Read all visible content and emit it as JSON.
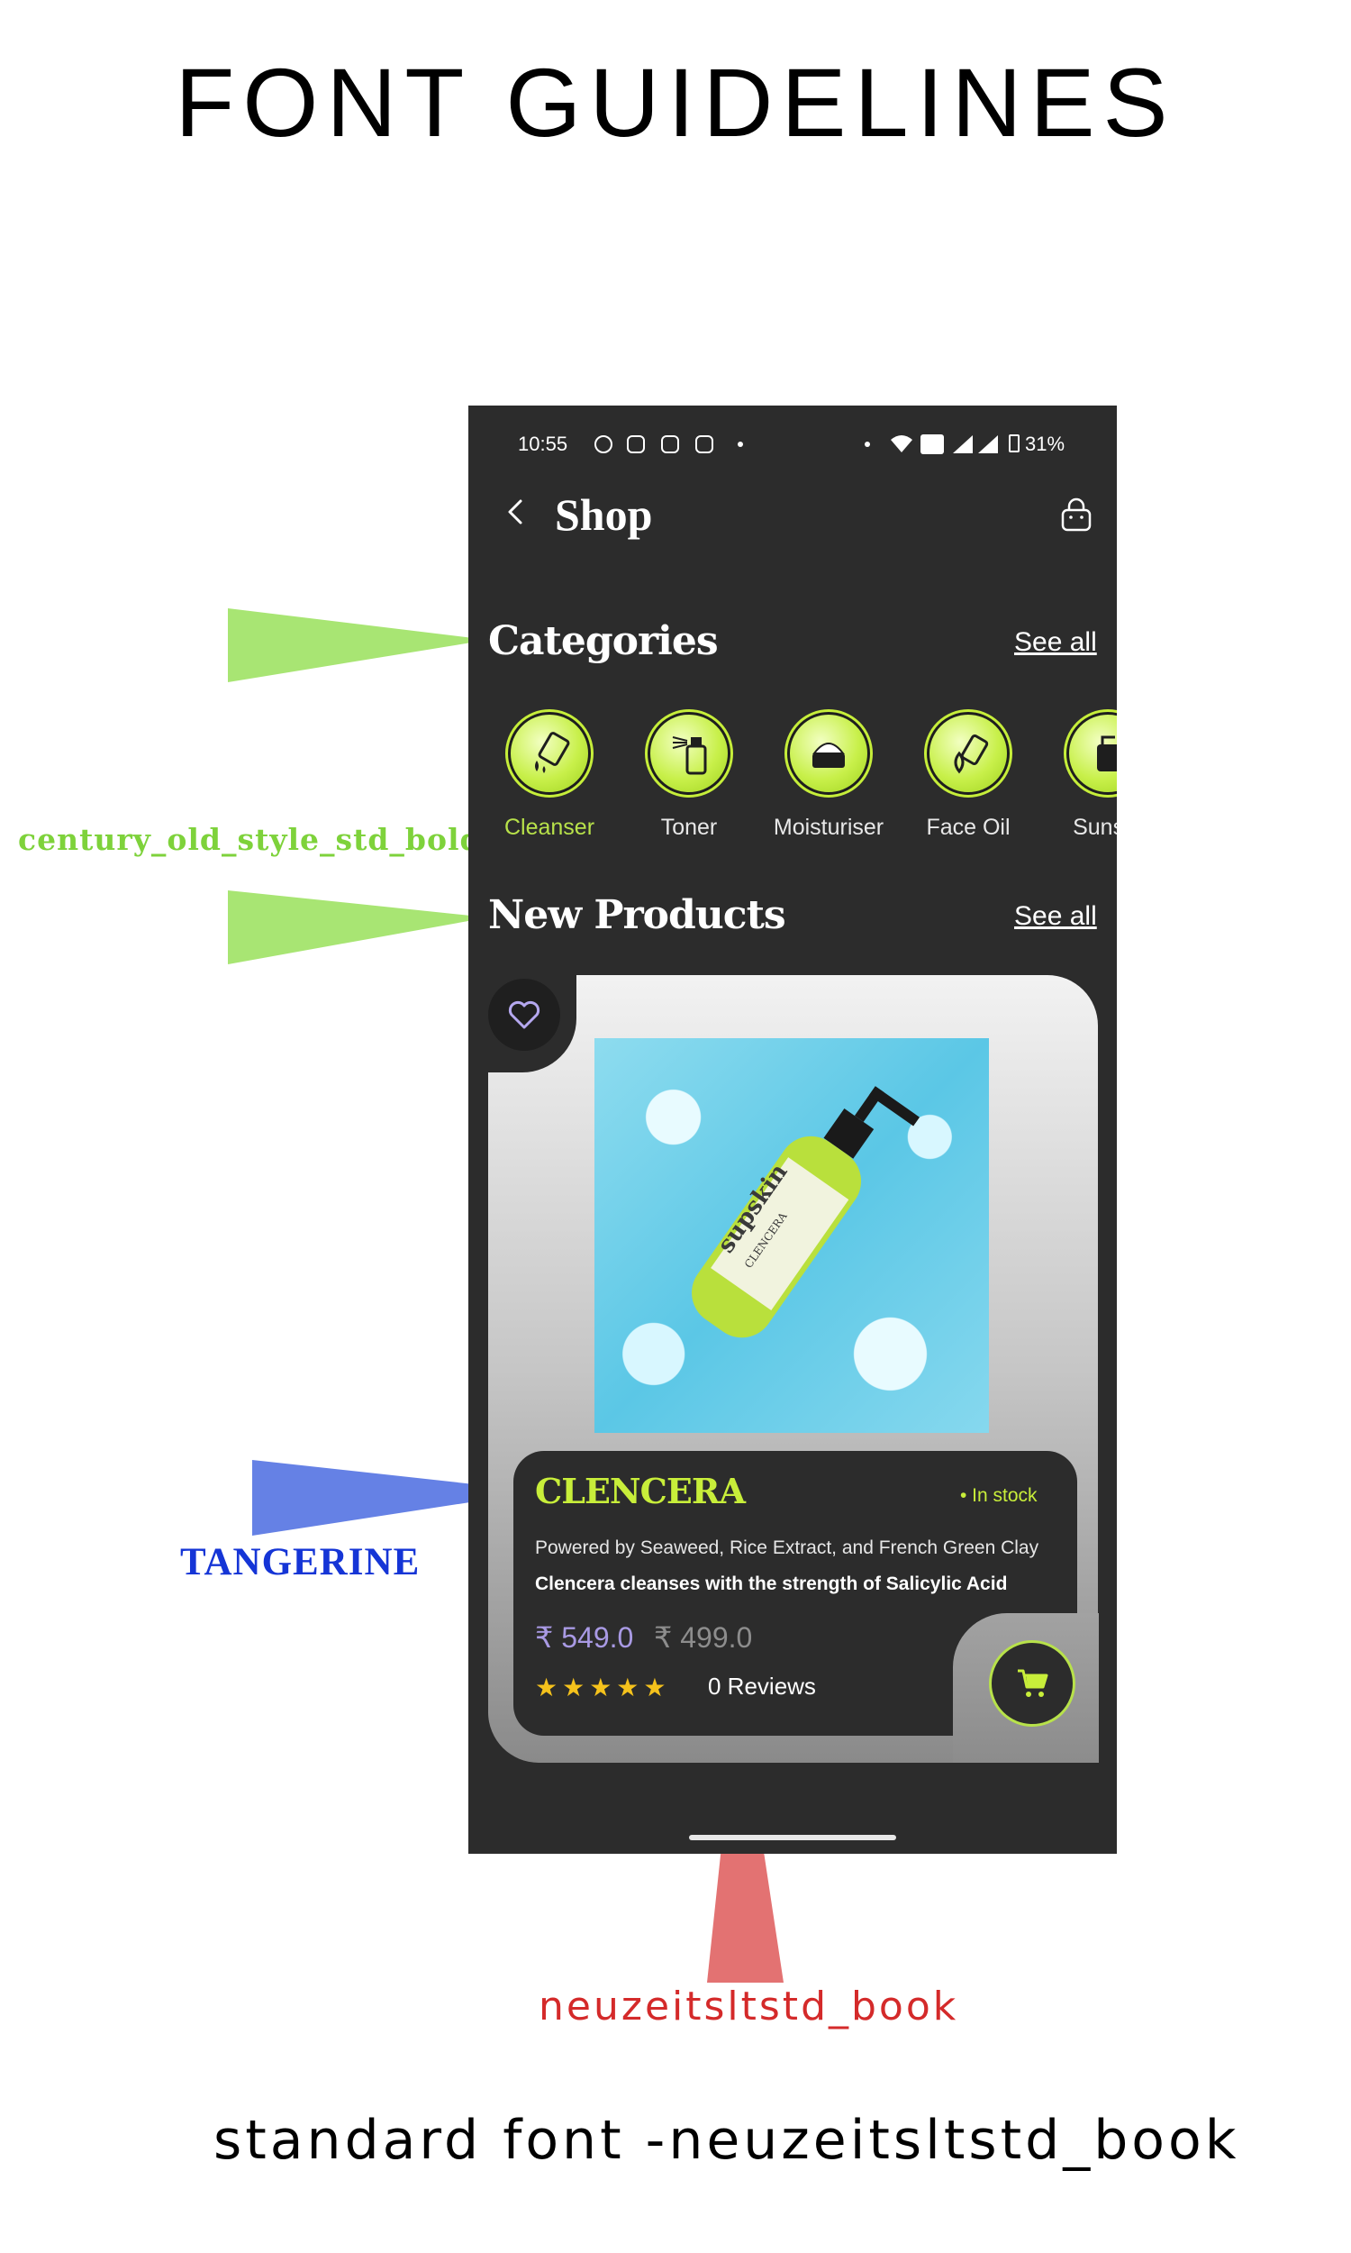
{
  "page": {
    "title": "FONT GUIDELINES",
    "footer_note": "standard font -neuzeitsltstd_book"
  },
  "annotations": [
    {
      "label": "century_old_style_std_bold",
      "color": "#7ed23b"
    },
    {
      "label": "TANGERINE",
      "color": "#1535d6"
    },
    {
      "label": "neuzeitsltstd_book",
      "color": "#d42a2a"
    }
  ],
  "phone": {
    "status_bar": {
      "time": "10:55",
      "battery": "31%"
    },
    "header": {
      "title": "Shop",
      "back_icon": "chevron-left-icon",
      "cart_icon": "shopping-bag-icon"
    },
    "categories": {
      "title": "Categories",
      "see_all": "See all",
      "items": [
        {
          "label": "Cleanser",
          "active": true
        },
        {
          "label": "Toner"
        },
        {
          "label": "Moisturiser"
        },
        {
          "label": "Face Oil"
        },
        {
          "label": "Sunscr"
        }
      ]
    },
    "new_products": {
      "title": "New Products",
      "see_all": "See all",
      "product": {
        "name": "CLENCERA",
        "stock": "• In stock",
        "description": "Powered by Seaweed, Rice Extract, and French Green Clay",
        "tagline": "Clencera cleanses with the strength of Salicylic Acid",
        "price": "₹ 549.0",
        "old_price": "₹ 499.0",
        "rating": 5,
        "stars": "★★★★★",
        "reviews": "0 Reviews",
        "image_brand": "supskin",
        "image_name": "CLENCERA"
      }
    },
    "colors": {
      "background": "#2c2c2c",
      "accent": "#c8ee3a",
      "price": "#a99ae4",
      "stars": "#f5c21c"
    }
  }
}
